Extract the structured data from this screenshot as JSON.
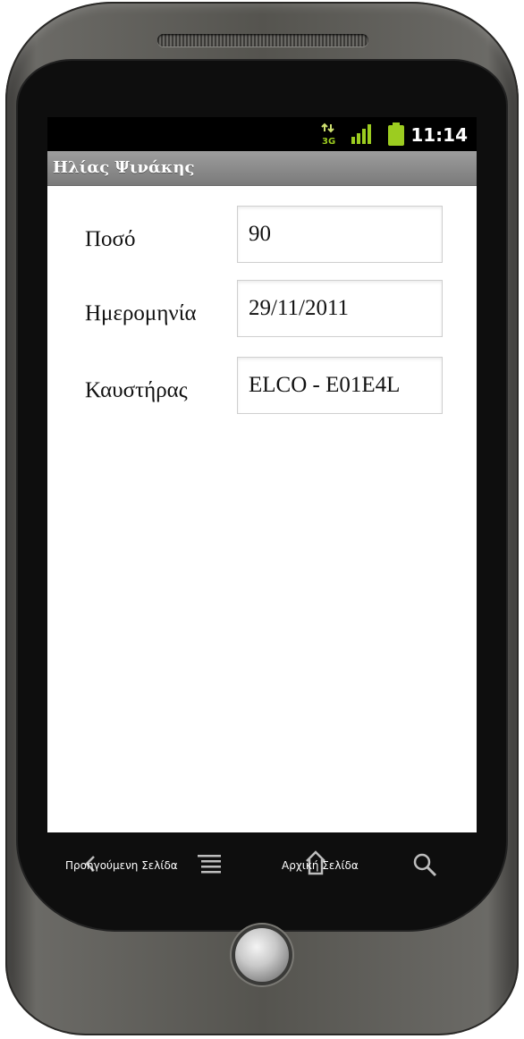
{
  "status_bar": {
    "time": "11:14",
    "network_type": "3G",
    "icons": [
      "data-arrows-icon",
      "signal-bars-icon",
      "battery-icon"
    ]
  },
  "title_bar": {
    "title": "Ηλίας Ψινάκης"
  },
  "form": {
    "rows": [
      {
        "label": "Ποσό",
        "value": "90"
      },
      {
        "label": "Ημερομηνία",
        "value": "29/11/2011"
      },
      {
        "label": "Καυστήρας",
        "value": "ELCO - E01E4L"
      }
    ]
  },
  "nav": {
    "back_label": "Προηγούμενη Σελίδα",
    "home_label": "Αρχική Σελίδα",
    "icons": [
      "back-arrow-icon",
      "menu-icon",
      "home-icon",
      "search-icon"
    ]
  },
  "colors": {
    "status_bar_bg": "#000000",
    "title_bar_bg": "#8c8c8c",
    "battery_green": "#9ccc20",
    "phone_body": "#5e5d59"
  }
}
